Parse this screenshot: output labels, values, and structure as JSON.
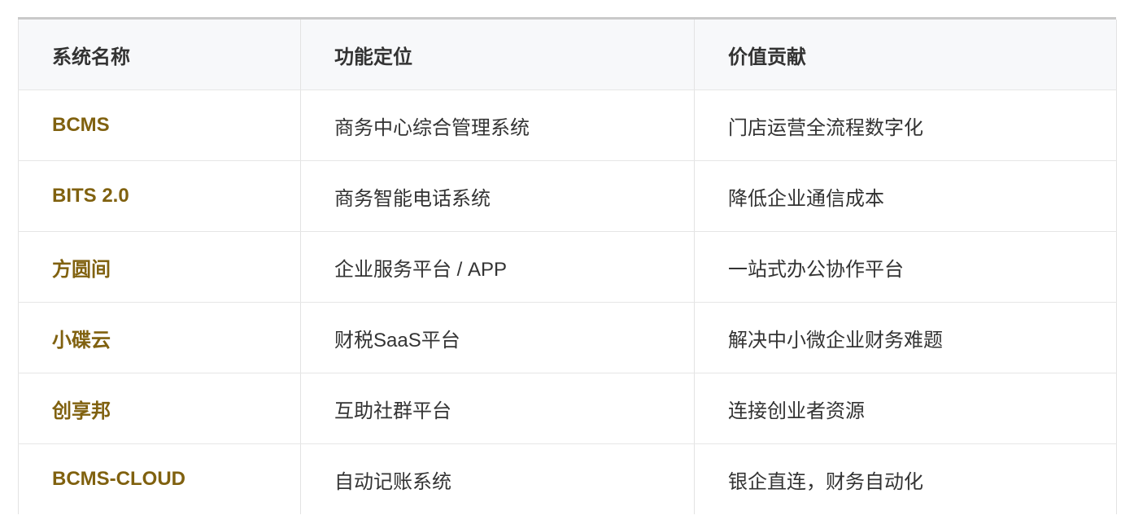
{
  "table": {
    "headers": [
      "系统名称",
      "功能定位",
      "价值贡献"
    ],
    "rows": [
      {
        "name": "BCMS",
        "role": "商务中心综合管理系统",
        "value": "门店运营全流程数字化"
      },
      {
        "name": "BITS 2.0",
        "role": "商务智能电话系统",
        "value": "降低企业通信成本"
      },
      {
        "name": "方圆间",
        "role": "企业服务平台 / APP",
        "value": "一站式办公协作平台"
      },
      {
        "name": "小碟云",
        "role": "财税SaaS平台",
        "value": "解决中小微企业财务难题"
      },
      {
        "name": "创享邦",
        "role": "互助社群平台",
        "value": "连接创业者资源"
      },
      {
        "name": "BCMS-CLOUD",
        "role": "自动记账系统",
        "value": "银企直连，财务自动化"
      }
    ],
    "colors": {
      "name_text": "#80610f",
      "header_bg": "#f7f8fa",
      "border": "#e3e3e3"
    }
  }
}
